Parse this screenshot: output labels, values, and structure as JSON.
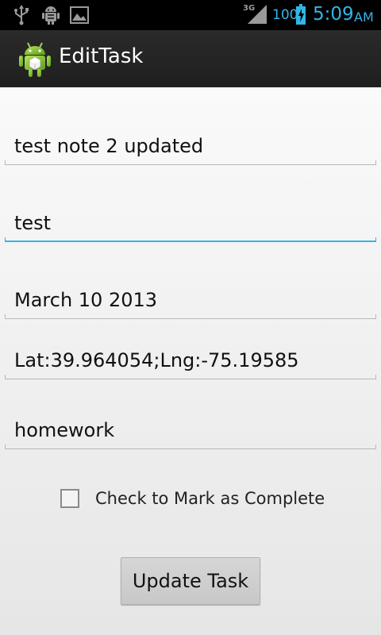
{
  "status_bar": {
    "network_label": "3G",
    "battery_level": "100",
    "time": "5:09",
    "ampm": "AM",
    "left_icons": [
      "usb-icon",
      "android-debug-icon",
      "image-icon"
    ],
    "accent_color": "#33b5e5"
  },
  "action_bar": {
    "title": "EditTask",
    "icon": "android-app-icon"
  },
  "form": {
    "task_name": "test note 2 updated",
    "description": "test",
    "date": "March 10 2013",
    "location": "Lat:39.964054;Lng:-75.19585",
    "category": "homework",
    "complete_checkbox_label": "Check to Mark as Complete",
    "complete_checked": false,
    "update_button_label": "Update Task"
  }
}
